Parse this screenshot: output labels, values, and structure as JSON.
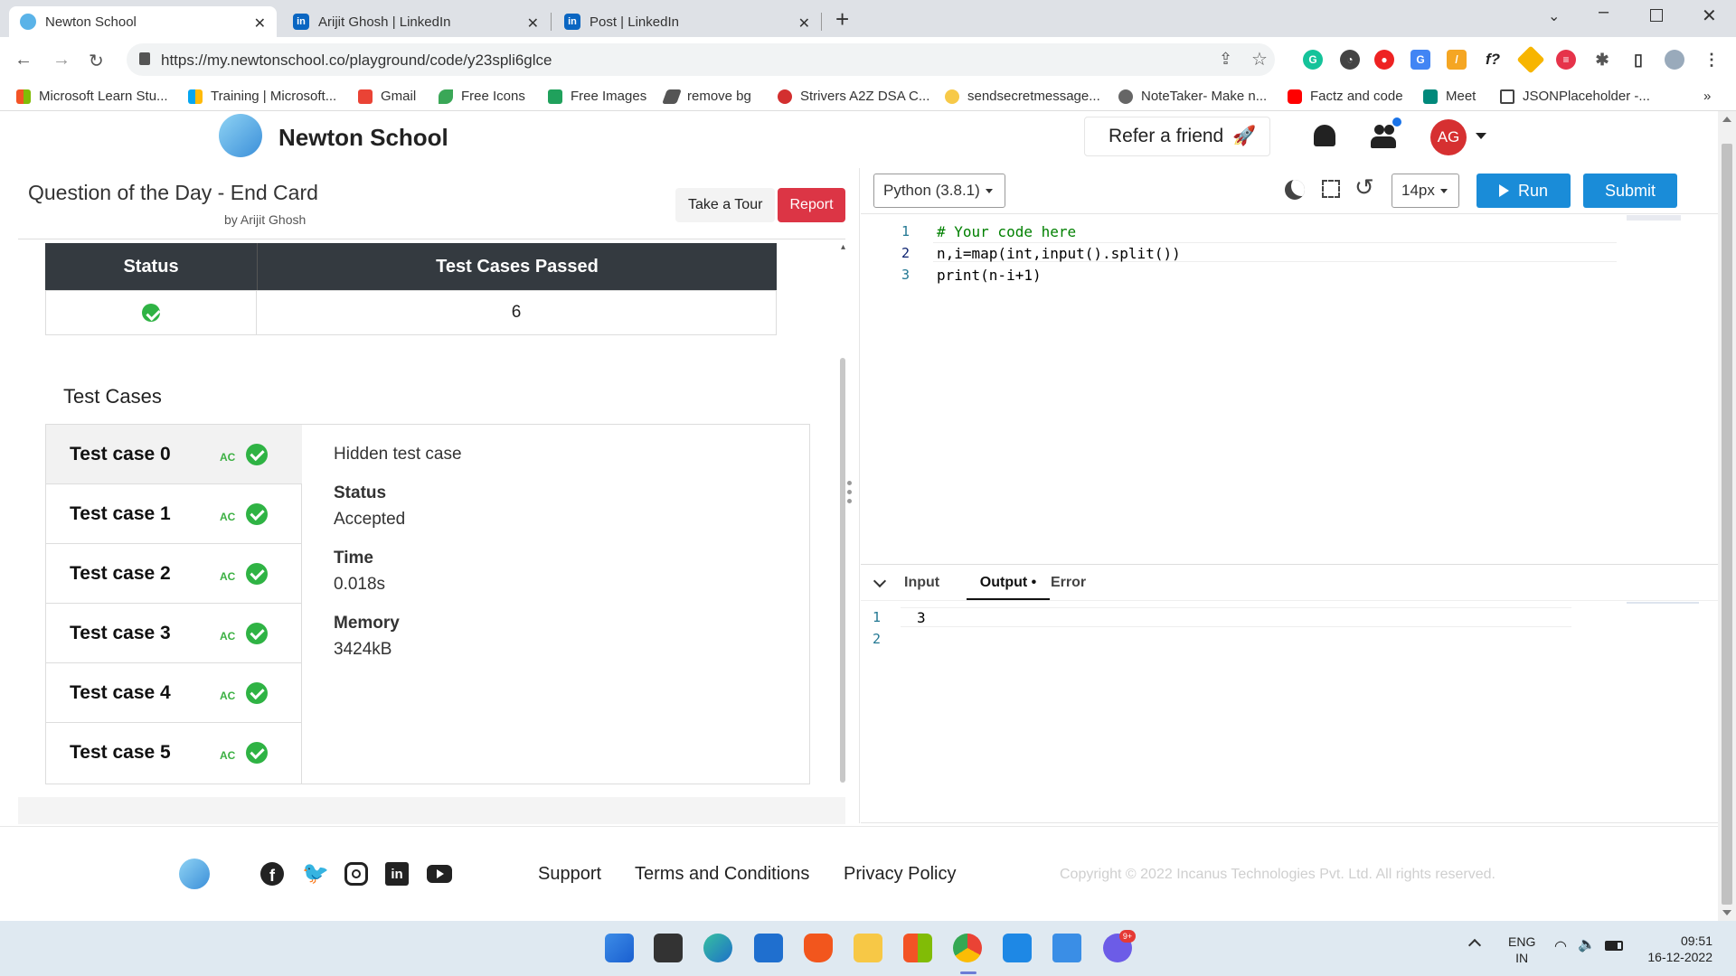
{
  "browser": {
    "tabs": [
      {
        "title": "Newton School",
        "active": true
      },
      {
        "title": "Arijit Ghosh | LinkedIn",
        "active": false
      },
      {
        "title": "Post | LinkedIn",
        "active": false
      }
    ],
    "new_tab": "+",
    "url": "https://my.newtonschool.co/playground/code/y23spli6glce",
    "bookmarks": [
      "Microsoft Learn Stu...",
      "Training | Microsoft...",
      "Gmail",
      "Free Icons",
      "Free Images",
      "remove bg",
      "Strivers A2Z DSA C...",
      "sendsecretmessage...",
      "NoteTaker- Make n...",
      "Factz and code",
      "Meet",
      "JSONPlaceholder -..."
    ],
    "more_bookmarks": "»"
  },
  "header": {
    "brand": "Newton School",
    "refer": "Refer a friend",
    "avatar": "AG"
  },
  "question": {
    "title": "Question of the Day - End Card",
    "author": "by Arijit Ghosh",
    "tour_button": "Take a Tour",
    "report_button": "Report"
  },
  "summary": {
    "headers": [
      "Status",
      "Test Cases Passed"
    ],
    "passed": "6"
  },
  "test_cases": {
    "heading": "Test Cases",
    "items": [
      {
        "label": "Test case 0",
        "verdict": "AC"
      },
      {
        "label": "Test case 1",
        "verdict": "AC"
      },
      {
        "label": "Test case 2",
        "verdict": "AC"
      },
      {
        "label": "Test case 3",
        "verdict": "AC"
      },
      {
        "label": "Test case 4",
        "verdict": "AC"
      },
      {
        "label": "Test case 5",
        "verdict": "AC"
      }
    ],
    "detail": {
      "title": "Hidden test case",
      "status_label": "Status",
      "status_value": "Accepted",
      "time_label": "Time",
      "time_value": "0.018s",
      "memory_label": "Memory",
      "memory_value": "3424kB"
    }
  },
  "editor": {
    "language": "Python (3.8.1)",
    "font_size": "14px",
    "run": "Run",
    "submit": "Submit",
    "line_numbers": [
      "1",
      "2",
      "3"
    ],
    "code": [
      "# Your code here",
      "n,i=map(int,input().split())",
      "print(n-i+1)"
    ],
    "io_tabs": [
      "Input",
      "Output •",
      "Error"
    ],
    "output_line_numbers": [
      "1",
      "2"
    ],
    "output": [
      "3"
    ]
  },
  "footer": {
    "links": [
      "Support",
      "Terms and Conditions",
      "Privacy Policy"
    ],
    "copyright": "Copyright © 2022 Incanus Technologies Pvt. Ltd. All rights reserved."
  },
  "taskbar": {
    "lang": "ENG",
    "region": "IN",
    "time": "09:51",
    "date": "16-12-2022",
    "badge": "9+"
  },
  "colors": {
    "report_red": "#dc3545",
    "run_blue": "#1a8cd8",
    "header_dark": "#343a40",
    "success_green": "#2fb344"
  }
}
